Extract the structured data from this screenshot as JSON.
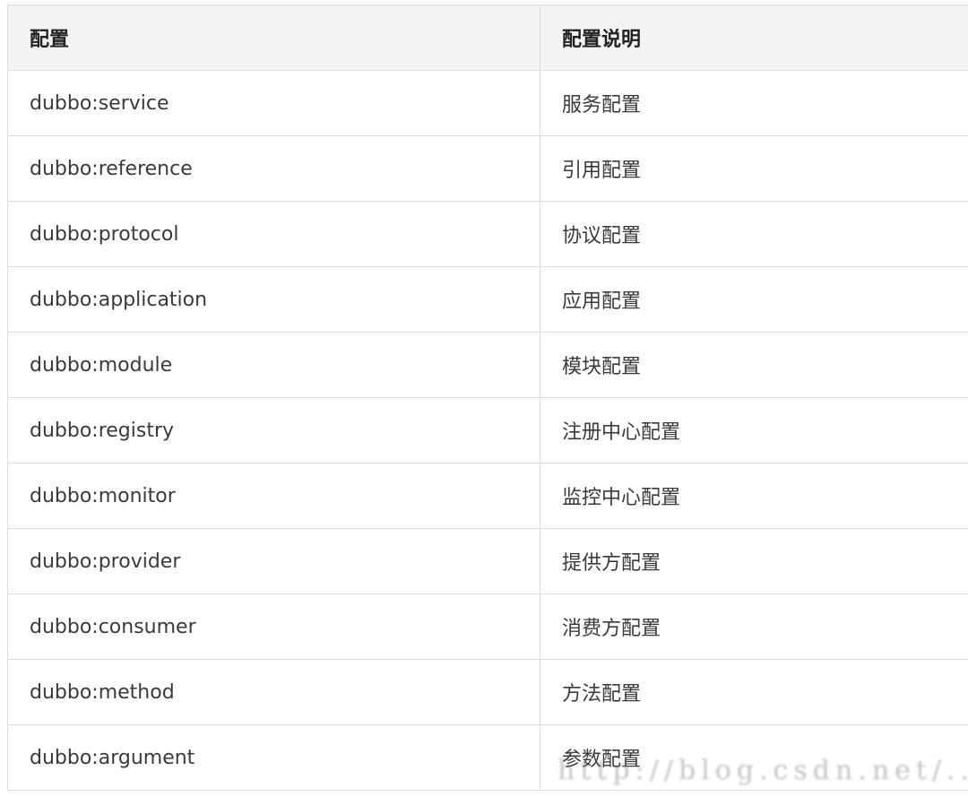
{
  "table": {
    "headers": [
      "配置",
      "配置说明"
    ],
    "rows": [
      {
        "key": "dubbo:service",
        "desc": "服务配置"
      },
      {
        "key": "dubbo:reference",
        "desc": "引用配置"
      },
      {
        "key": "dubbo:protocol",
        "desc": "协议配置"
      },
      {
        "key": "dubbo:application",
        "desc": "应用配置"
      },
      {
        "key": "dubbo:module",
        "desc": "模块配置"
      },
      {
        "key": "dubbo:registry",
        "desc": "注册中心配置"
      },
      {
        "key": "dubbo:monitor",
        "desc": "监控中心配置"
      },
      {
        "key": "dubbo:provider",
        "desc": "提供方配置"
      },
      {
        "key": "dubbo:consumer",
        "desc": "消费方配置"
      },
      {
        "key": "dubbo:method",
        "desc": "方法配置"
      },
      {
        "key": "dubbo:argument",
        "desc": "参数配置"
      }
    ]
  },
  "watermark": {
    "text": "http://blog.csdn.net/..."
  }
}
